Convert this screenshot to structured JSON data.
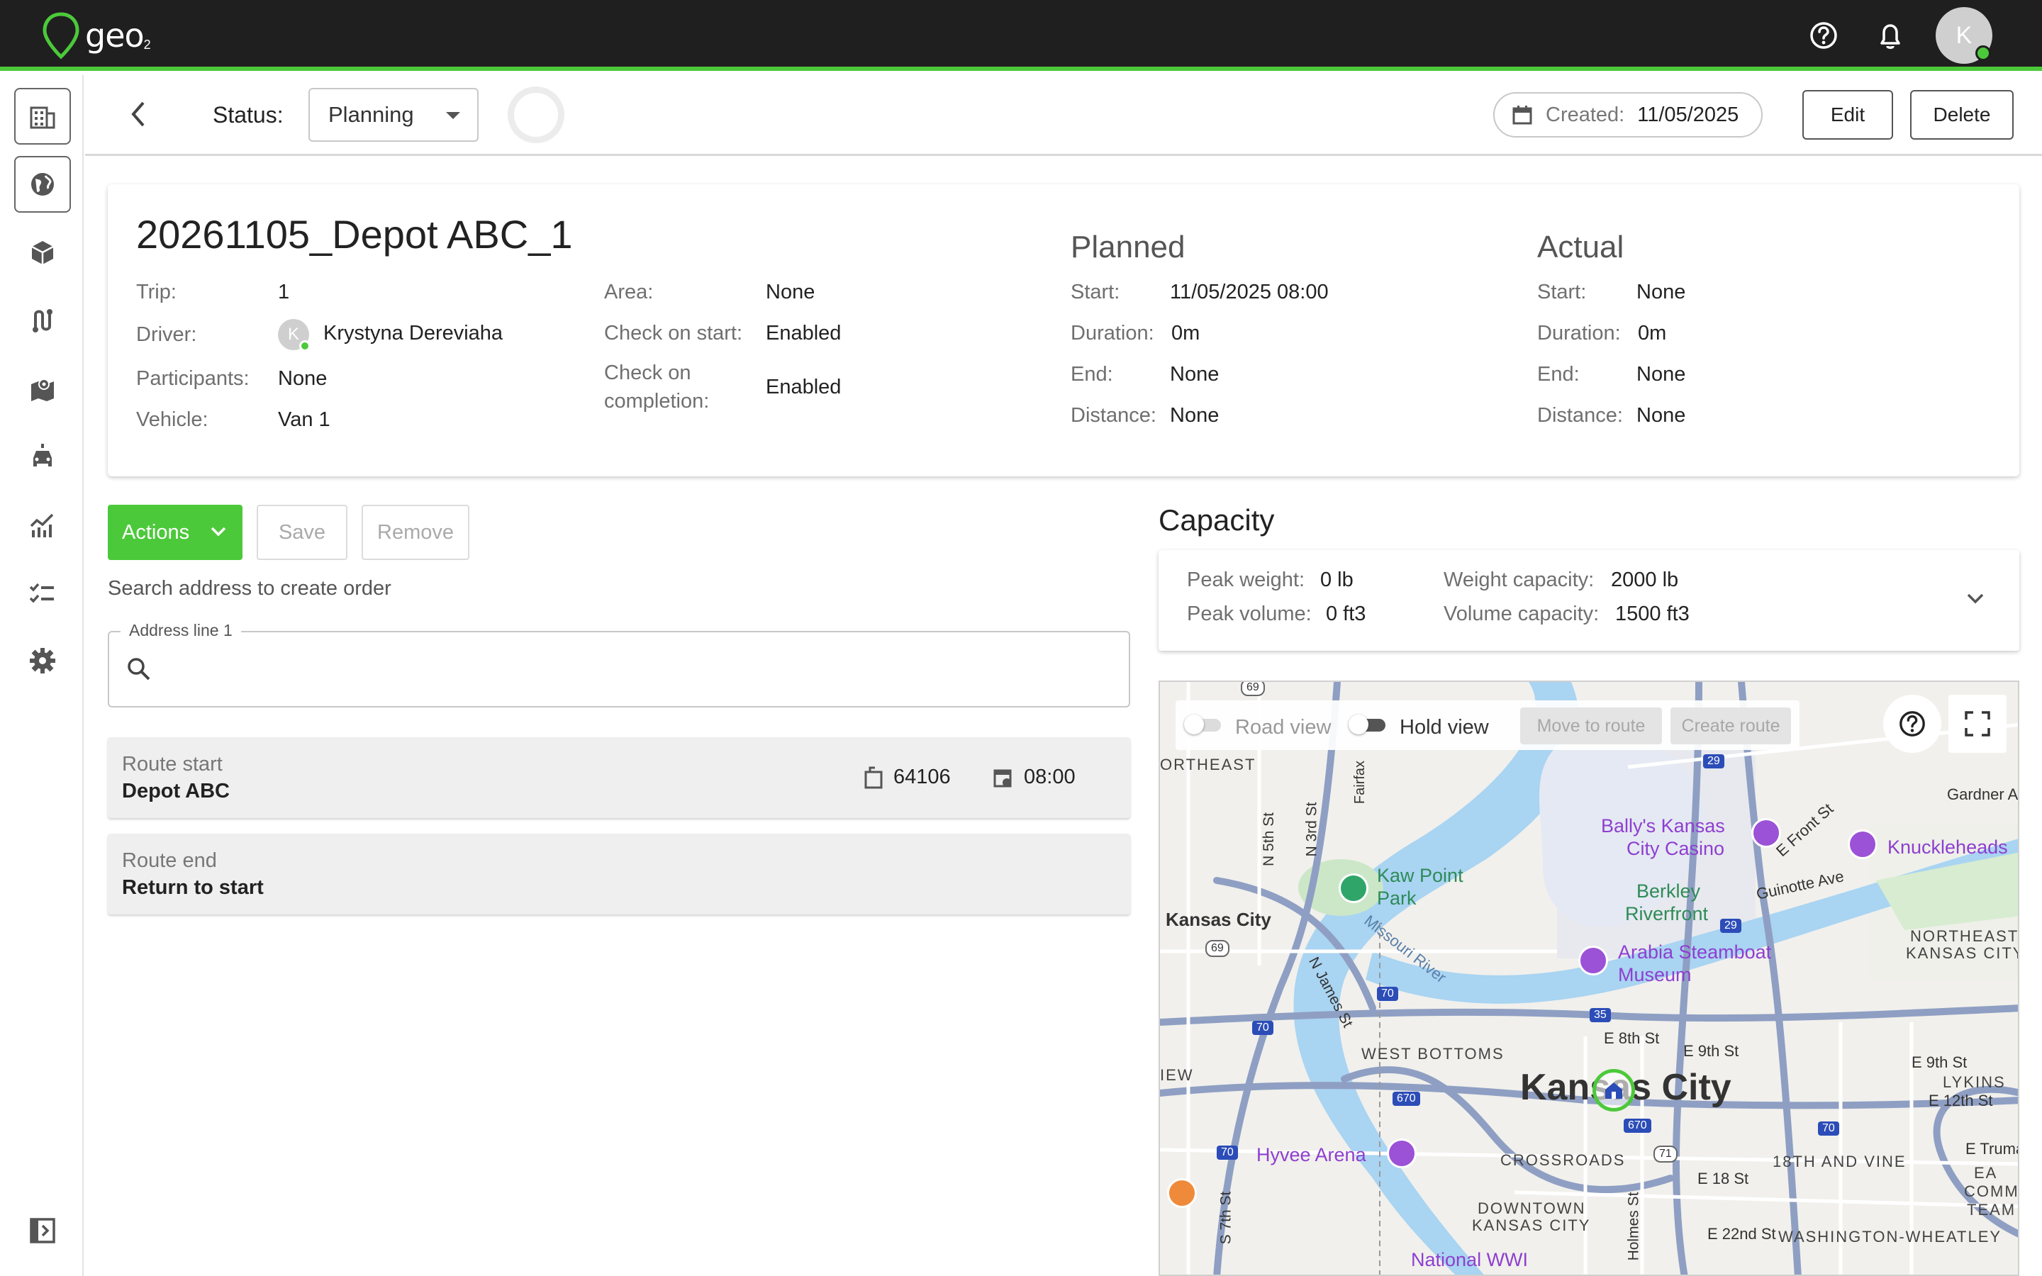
{
  "app": {
    "logo_text": "geo",
    "logo_sub": "2",
    "user_initial": "K"
  },
  "header": {
    "status_label": "Status:",
    "status_value": "Planning",
    "created_label": "Created:",
    "created_value": "11/05/2025",
    "edit_label": "Edit",
    "delete_label": "Delete"
  },
  "trip": {
    "title": "20261105_Depot ABC_1",
    "fields_left": [
      {
        "label": "Trip:",
        "value": "1"
      },
      {
        "label": "Driver:",
        "value": "Krystyna Dereviaha"
      },
      {
        "label": "Participants:",
        "value": "None"
      },
      {
        "label": "Vehicle:",
        "value": "Van 1"
      }
    ],
    "driver_initial": "K",
    "fields_mid": [
      {
        "label": "Area:",
        "value": "None"
      },
      {
        "label": "Check on start:",
        "value": "Enabled"
      },
      {
        "label_line1": "Check on",
        "label_line2": "completion:",
        "value": "Enabled"
      }
    ],
    "planned": {
      "heading": "Planned",
      "rows": [
        {
          "label": "Start:",
          "value": "11/05/2025 08:00"
        },
        {
          "label": "Duration:",
          "value": "0m"
        },
        {
          "label": "End:",
          "value": "None"
        },
        {
          "label": "Distance:",
          "value": "None"
        }
      ]
    },
    "actual": {
      "heading": "Actual",
      "rows": [
        {
          "label": "Start:",
          "value": "None"
        },
        {
          "label": "Duration:",
          "value": "0m"
        },
        {
          "label": "End:",
          "value": "None"
        },
        {
          "label": "Distance:",
          "value": "None"
        }
      ]
    }
  },
  "actions": {
    "actions_label": "Actions",
    "save_label": "Save",
    "remove_label": "Remove",
    "search_caption": "Search address to create order",
    "address_legend": "Address line 1"
  },
  "route": {
    "start": {
      "label": "Route start",
      "value": "Depot ABC",
      "zip": "64106",
      "time": "08:00"
    },
    "end": {
      "label": "Route end",
      "value": "Return to start"
    }
  },
  "capacity": {
    "title": "Capacity",
    "peak_weight_label": "Peak weight:",
    "peak_weight_value": "0 lb",
    "peak_volume_label": "Peak volume:",
    "peak_volume_value": "0 ft3",
    "weight_capacity_label": "Weight capacity:",
    "weight_capacity_value": "2000 lb",
    "volume_capacity_label": "Volume capacity:",
    "volume_capacity_value": "1500 ft3"
  },
  "map": {
    "road_view_label": "Road view",
    "hold_view_label": "Hold view",
    "move_to_route_label": "Move to route",
    "create_route_label": "Create route",
    "labels": {
      "northeast_left": "ORTHEAST",
      "fairfax": "Fairfax",
      "gardner": "Gardner A",
      "bally": "Bally's Kansas",
      "bally2": "City Casino",
      "knuckleheads": "Knuckleheads",
      "efront": "E Front St",
      "kaw1": "Kaw Point",
      "kaw2": "Park",
      "n5th": "N 5th St",
      "n3rd": "N 3rd St",
      "berkley1": "Berkley",
      "berkley2": "Riverfront",
      "guinotte": "Guinotte Ave",
      "kc_small": "Kansas City",
      "nekc1": "NORTHEAST",
      "nekc2": "KANSAS CITY",
      "missouri": "Missouri River",
      "arabia1": "Arabia Steamboat",
      "arabia2": "Museum",
      "njames": "N James St",
      "e8th": "E 8th St",
      "e9th": "E 9th St",
      "e9th2": "E 9th St",
      "westbottoms": "WEST BOTTOMS",
      "lykins": "LYKINS",
      "e12th": "E 12th St",
      "view": "IEW",
      "kc_big": "Kansas City",
      "hyvee": "Hyvee Arena",
      "crossroads": "CROSSROADS",
      "18th": "18TH AND VINE",
      "etruman": "E Truma",
      "ea": "EA",
      "comm": "COMM",
      "team": "TEAM",
      "s7th": "S 7th St",
      "downtown1": "DOWNTOWN",
      "downtown2": "KANSAS CITY",
      "e18": "E 18 St",
      "holmes": "Holmes St",
      "e22": "E 22nd St",
      "wash": "WASHINGTON-WHEATLEY",
      "nationalww": "National WWI",
      "i29": "29",
      "i29b": "29",
      "i35": "35",
      "i70a": "70",
      "i70b": "70",
      "i70c": "70",
      "i70d": "70",
      "i670a": "670",
      "i670b": "670",
      "us69": "69",
      "us71": "71",
      "i69top": "69"
    }
  }
}
